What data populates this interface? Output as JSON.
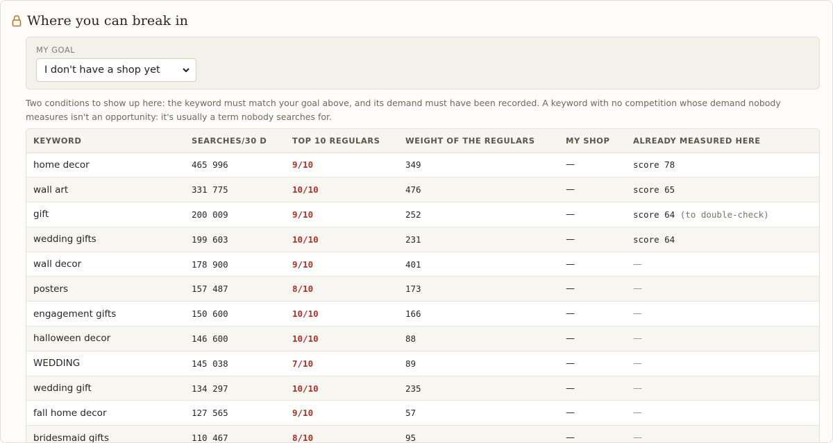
{
  "header": {
    "title": "Where you can break in",
    "icon": "lock-icon"
  },
  "goal": {
    "label": "MY GOAL",
    "selected": "I don't have a shop yet"
  },
  "note": "Two conditions to show up here: the keyword must match your goal above, and its demand must have been recorded. A keyword with no competition whose demand nobody measures isn't an opportunity: it's usually a term nobody searches for.",
  "table": {
    "columns": [
      "KEYWORD",
      "SEARCHES/30 D",
      "TOP 10 REGULARS",
      "WEIGHT OF THE REGULARS",
      "MY SHOP",
      "ALREADY MEASURED HERE"
    ],
    "rows": [
      {
        "keyword": "home decor",
        "searches": "465 996",
        "regulars": "9/10",
        "weight": "349",
        "my_shop": "—",
        "measured": "score 78",
        "hint": ""
      },
      {
        "keyword": "wall art",
        "searches": "331 775",
        "regulars": "10/10",
        "weight": "476",
        "my_shop": "—",
        "measured": "score 65",
        "hint": ""
      },
      {
        "keyword": "gift",
        "searches": "200 009",
        "regulars": "9/10",
        "weight": "252",
        "my_shop": "—",
        "measured": "score 64",
        "hint": "(to double-check)"
      },
      {
        "keyword": "wedding gifts",
        "searches": "199 603",
        "regulars": "10/10",
        "weight": "231",
        "my_shop": "—",
        "measured": "score 64",
        "hint": ""
      },
      {
        "keyword": "wall decor",
        "searches": "178 900",
        "regulars": "9/10",
        "weight": "401",
        "my_shop": "—",
        "measured": "—",
        "hint": ""
      },
      {
        "keyword": "posters",
        "searches": "157 487",
        "regulars": "8/10",
        "weight": "173",
        "my_shop": "—",
        "measured": "—",
        "hint": ""
      },
      {
        "keyword": "engagement gifts",
        "searches": "150 600",
        "regulars": "10/10",
        "weight": "166",
        "my_shop": "—",
        "measured": "—",
        "hint": ""
      },
      {
        "keyword": "halloween decor",
        "searches": "146 600",
        "regulars": "10/10",
        "weight": "88",
        "my_shop": "—",
        "measured": "—",
        "hint": ""
      },
      {
        "keyword": "WEDDING",
        "searches": "145 038",
        "regulars": "7/10",
        "weight": "89",
        "my_shop": "—",
        "measured": "—",
        "hint": ""
      },
      {
        "keyword": "wedding gift",
        "searches": "134 297",
        "regulars": "10/10",
        "weight": "235",
        "my_shop": "—",
        "measured": "—",
        "hint": ""
      },
      {
        "keyword": "fall home decor",
        "searches": "127 565",
        "regulars": "9/10",
        "weight": "57",
        "my_shop": "—",
        "measured": "—",
        "hint": ""
      },
      {
        "keyword": "bridesmaid gifts",
        "searches": "110 467",
        "regulars": "8/10",
        "weight": "95",
        "my_shop": "—",
        "measured": "—",
        "hint": ""
      }
    ]
  }
}
